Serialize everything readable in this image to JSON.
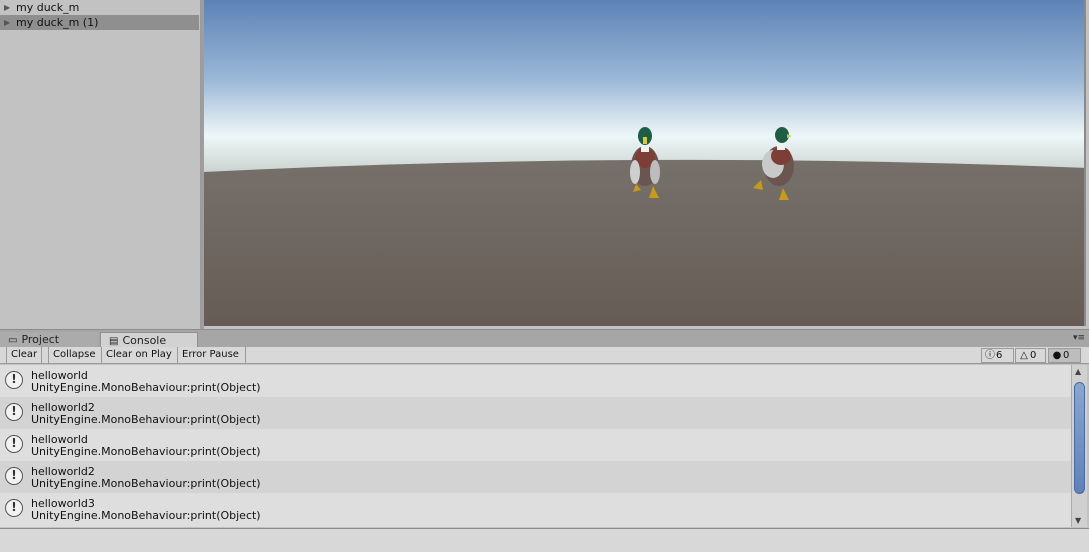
{
  "hierarchy": {
    "items": [
      {
        "label": "my duck_m",
        "selected": false
      },
      {
        "label": "my duck_m (1)",
        "selected": true
      }
    ]
  },
  "panel_tabs": {
    "project": "Project",
    "console": "Console"
  },
  "console_toolbar": {
    "clear": "Clear",
    "collapse": "Collapse",
    "clear_on_play": "Clear on Play",
    "error_pause": "Error Pause",
    "info_count": "6",
    "warning_count": "0",
    "error_count": "0"
  },
  "log_entries": [
    {
      "message": "helloworld",
      "trace": "UnityEngine.MonoBehaviour:print(Object)"
    },
    {
      "message": "helloworld2",
      "trace": "UnityEngine.MonoBehaviour:print(Object)"
    },
    {
      "message": "helloworld",
      "trace": "UnityEngine.MonoBehaviour:print(Object)"
    },
    {
      "message": "helloworld2",
      "trace": "UnityEngine.MonoBehaviour:print(Object)"
    },
    {
      "message": "helloworld3",
      "trace": "UnityEngine.MonoBehaviour:print(Object)"
    }
  ],
  "icons": {
    "info": "info-icon",
    "warning": "warning-icon",
    "error": "error-icon"
  }
}
